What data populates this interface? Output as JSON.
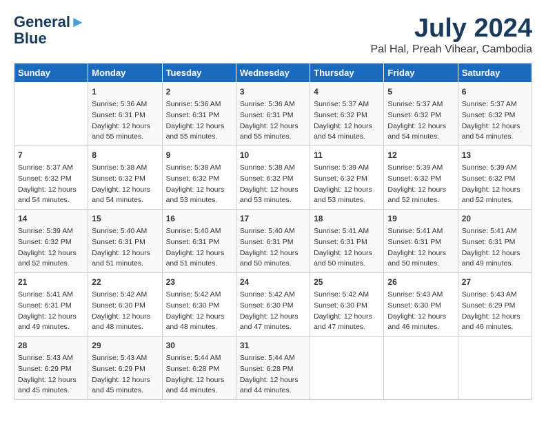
{
  "header": {
    "logo_line1": "General",
    "logo_line2": "Blue",
    "month": "July 2024",
    "location": "Pal Hal, Preah Vihear, Cambodia"
  },
  "weekdays": [
    "Sunday",
    "Monday",
    "Tuesday",
    "Wednesday",
    "Thursday",
    "Friday",
    "Saturday"
  ],
  "weeks": [
    [
      {
        "day": "",
        "text": ""
      },
      {
        "day": "1",
        "text": "Sunrise: 5:36 AM\nSunset: 6:31 PM\nDaylight: 12 hours\nand 55 minutes."
      },
      {
        "day": "2",
        "text": "Sunrise: 5:36 AM\nSunset: 6:31 PM\nDaylight: 12 hours\nand 55 minutes."
      },
      {
        "day": "3",
        "text": "Sunrise: 5:36 AM\nSunset: 6:31 PM\nDaylight: 12 hours\nand 55 minutes."
      },
      {
        "day": "4",
        "text": "Sunrise: 5:37 AM\nSunset: 6:32 PM\nDaylight: 12 hours\nand 54 minutes."
      },
      {
        "day": "5",
        "text": "Sunrise: 5:37 AM\nSunset: 6:32 PM\nDaylight: 12 hours\nand 54 minutes."
      },
      {
        "day": "6",
        "text": "Sunrise: 5:37 AM\nSunset: 6:32 PM\nDaylight: 12 hours\nand 54 minutes."
      }
    ],
    [
      {
        "day": "7",
        "text": "Sunrise: 5:37 AM\nSunset: 6:32 PM\nDaylight: 12 hours\nand 54 minutes."
      },
      {
        "day": "8",
        "text": "Sunrise: 5:38 AM\nSunset: 6:32 PM\nDaylight: 12 hours\nand 54 minutes."
      },
      {
        "day": "9",
        "text": "Sunrise: 5:38 AM\nSunset: 6:32 PM\nDaylight: 12 hours\nand 53 minutes."
      },
      {
        "day": "10",
        "text": "Sunrise: 5:38 AM\nSunset: 6:32 PM\nDaylight: 12 hours\nand 53 minutes."
      },
      {
        "day": "11",
        "text": "Sunrise: 5:39 AM\nSunset: 6:32 PM\nDaylight: 12 hours\nand 53 minutes."
      },
      {
        "day": "12",
        "text": "Sunrise: 5:39 AM\nSunset: 6:32 PM\nDaylight: 12 hours\nand 52 minutes."
      },
      {
        "day": "13",
        "text": "Sunrise: 5:39 AM\nSunset: 6:32 PM\nDaylight: 12 hours\nand 52 minutes."
      }
    ],
    [
      {
        "day": "14",
        "text": "Sunrise: 5:39 AM\nSunset: 6:32 PM\nDaylight: 12 hours\nand 52 minutes."
      },
      {
        "day": "15",
        "text": "Sunrise: 5:40 AM\nSunset: 6:31 PM\nDaylight: 12 hours\nand 51 minutes."
      },
      {
        "day": "16",
        "text": "Sunrise: 5:40 AM\nSunset: 6:31 PM\nDaylight: 12 hours\nand 51 minutes."
      },
      {
        "day": "17",
        "text": "Sunrise: 5:40 AM\nSunset: 6:31 PM\nDaylight: 12 hours\nand 50 minutes."
      },
      {
        "day": "18",
        "text": "Sunrise: 5:41 AM\nSunset: 6:31 PM\nDaylight: 12 hours\nand 50 minutes."
      },
      {
        "day": "19",
        "text": "Sunrise: 5:41 AM\nSunset: 6:31 PM\nDaylight: 12 hours\nand 50 minutes."
      },
      {
        "day": "20",
        "text": "Sunrise: 5:41 AM\nSunset: 6:31 PM\nDaylight: 12 hours\nand 49 minutes."
      }
    ],
    [
      {
        "day": "21",
        "text": "Sunrise: 5:41 AM\nSunset: 6:31 PM\nDaylight: 12 hours\nand 49 minutes."
      },
      {
        "day": "22",
        "text": "Sunrise: 5:42 AM\nSunset: 6:30 PM\nDaylight: 12 hours\nand 48 minutes."
      },
      {
        "day": "23",
        "text": "Sunrise: 5:42 AM\nSunset: 6:30 PM\nDaylight: 12 hours\nand 48 minutes."
      },
      {
        "day": "24",
        "text": "Sunrise: 5:42 AM\nSunset: 6:30 PM\nDaylight: 12 hours\nand 47 minutes."
      },
      {
        "day": "25",
        "text": "Sunrise: 5:42 AM\nSunset: 6:30 PM\nDaylight: 12 hours\nand 47 minutes."
      },
      {
        "day": "26",
        "text": "Sunrise: 5:43 AM\nSunset: 6:30 PM\nDaylight: 12 hours\nand 46 minutes."
      },
      {
        "day": "27",
        "text": "Sunrise: 5:43 AM\nSunset: 6:29 PM\nDaylight: 12 hours\nand 46 minutes."
      }
    ],
    [
      {
        "day": "28",
        "text": "Sunrise: 5:43 AM\nSunset: 6:29 PM\nDaylight: 12 hours\nand 45 minutes."
      },
      {
        "day": "29",
        "text": "Sunrise: 5:43 AM\nSunset: 6:29 PM\nDaylight: 12 hours\nand 45 minutes."
      },
      {
        "day": "30",
        "text": "Sunrise: 5:44 AM\nSunset: 6:28 PM\nDaylight: 12 hours\nand 44 minutes."
      },
      {
        "day": "31",
        "text": "Sunrise: 5:44 AM\nSunset: 6:28 PM\nDaylight: 12 hours\nand 44 minutes."
      },
      {
        "day": "",
        "text": ""
      },
      {
        "day": "",
        "text": ""
      },
      {
        "day": "",
        "text": ""
      }
    ]
  ]
}
